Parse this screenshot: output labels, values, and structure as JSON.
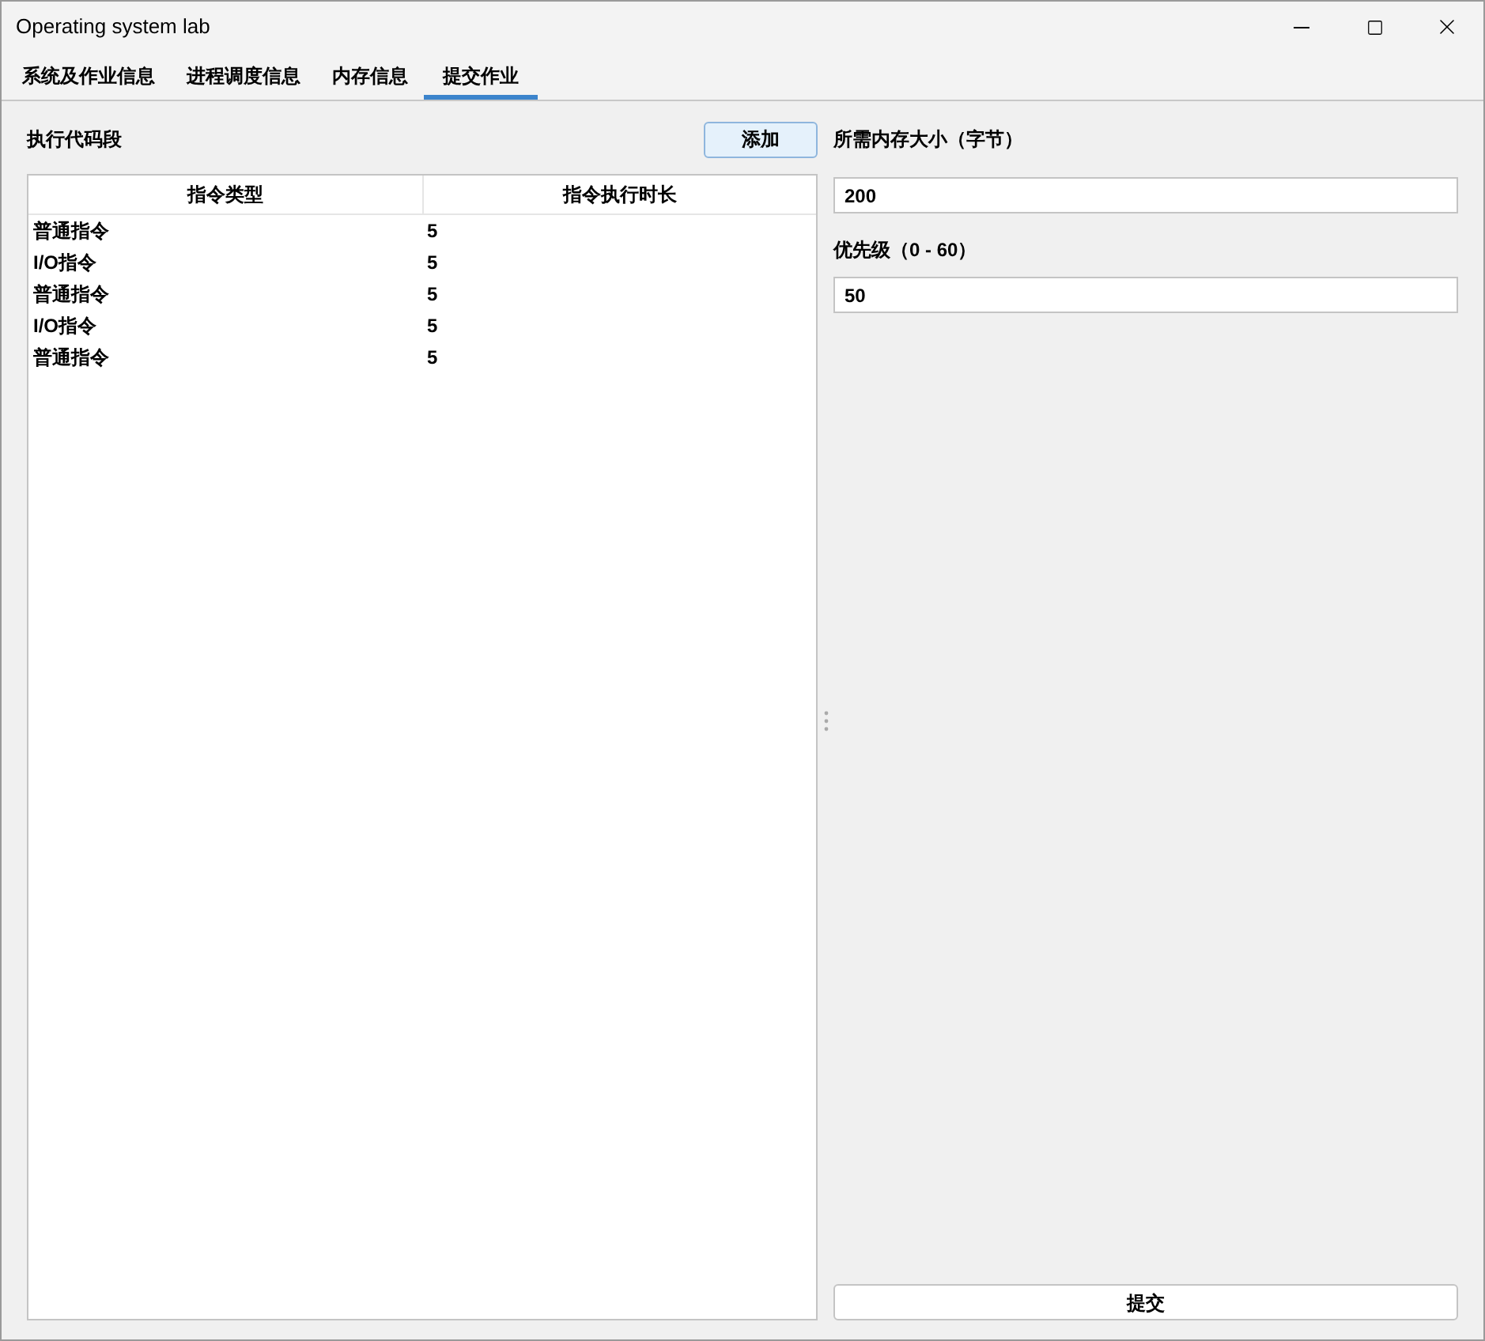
{
  "window": {
    "title": "Operating system lab"
  },
  "tabs": [
    {
      "label": "系统及作业信息",
      "selected": false
    },
    {
      "label": "进程调度信息",
      "selected": false
    },
    {
      "label": "内存信息",
      "selected": false
    },
    {
      "label": "提交作业",
      "selected": true
    }
  ],
  "code_section": {
    "title": "执行代码段",
    "add_button": "添加",
    "table": {
      "columns": [
        "指令类型",
        "指令执行时长"
      ],
      "rows": [
        [
          "普通指令",
          "5"
        ],
        [
          "I/O指令",
          "5"
        ],
        [
          "普通指令",
          "5"
        ],
        [
          "I/O指令",
          "5"
        ],
        [
          "普通指令",
          "5"
        ]
      ]
    }
  },
  "memory": {
    "label": "所需内存大小（字节）",
    "value": "200"
  },
  "priority": {
    "label": "优先级（0 - 60）",
    "value": "50"
  },
  "submit_button": "提交"
}
